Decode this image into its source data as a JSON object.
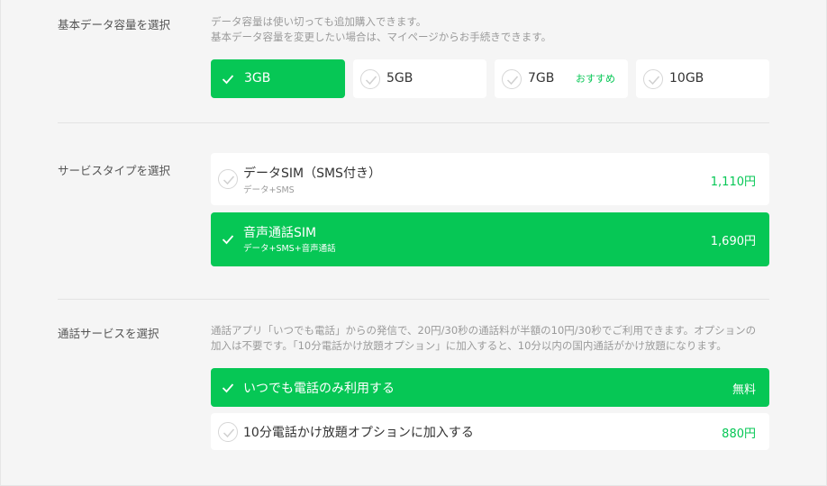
{
  "data_capacity": {
    "label": "基本データ容量を選択",
    "note_line1": "データ容量は使い切っても追加購入できます。",
    "note_line2": "基本データ容量を変更したい場合は、マイページからお手続きできます。",
    "options": [
      {
        "label": "3GB",
        "selected": true
      },
      {
        "label": "5GB",
        "selected": false
      },
      {
        "label": "7GB",
        "badge": "おすすめ",
        "selected": false
      },
      {
        "label": "10GB",
        "selected": false
      }
    ]
  },
  "service_type": {
    "label": "サービスタイプを選択",
    "options": [
      {
        "label": "データSIM（SMS付き）",
        "sub": "データ+SMS",
        "price": "1,110円",
        "selected": false
      },
      {
        "label": "音声通話SIM",
        "sub": "データ+SMS+音声通話",
        "price": "1,690円",
        "selected": true
      }
    ]
  },
  "call_service": {
    "label": "通話サービスを選択",
    "note_line1": "通話アプリ「いつでも電話」からの発信で、20円/30秒の通話料が半額の10円/30秒でご利用できます。オプションの",
    "note_line2": "加入は不要です。「10分電話かけ放題オプション」に加入すると、10分以内の国内通話がかけ放題になります。",
    "options": [
      {
        "label": "いつでも電話のみ利用する",
        "price": "無料",
        "selected": true
      },
      {
        "label": "10分電話かけ放題オプションに加入する",
        "price": "880円",
        "selected": false
      }
    ]
  },
  "colors": {
    "accent": "#06c755",
    "card": "#ffffff",
    "background": "#f5f5f5"
  },
  "icons": {
    "check": "check-icon"
  }
}
